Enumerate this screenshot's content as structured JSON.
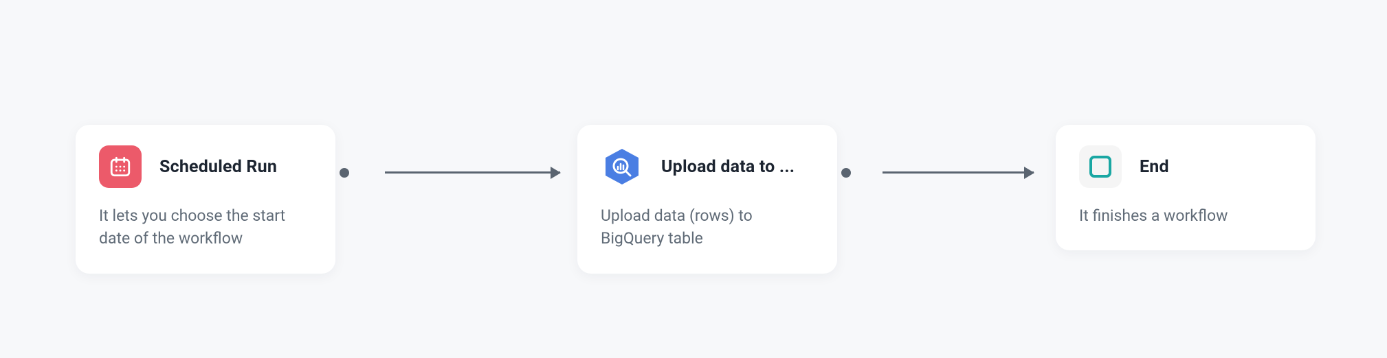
{
  "nodes": {
    "scheduled": {
      "title": "Scheduled Run",
      "description": "It lets you choose the start date of the workflow",
      "icon": "calendar-icon",
      "accent": "#ec5a6a"
    },
    "upload": {
      "title": "Upload data to ...",
      "description": "Upload data (rows) to BigQuery table",
      "icon": "bigquery-icon",
      "accent": "#4a7ee3"
    },
    "end": {
      "title": "End",
      "description": "It finishes a workflow",
      "icon": "end-square-icon",
      "accent": "#1aa7a3"
    }
  },
  "edges": [
    {
      "from": "scheduled",
      "to": "upload"
    },
    {
      "from": "upload",
      "to": "end"
    }
  ]
}
